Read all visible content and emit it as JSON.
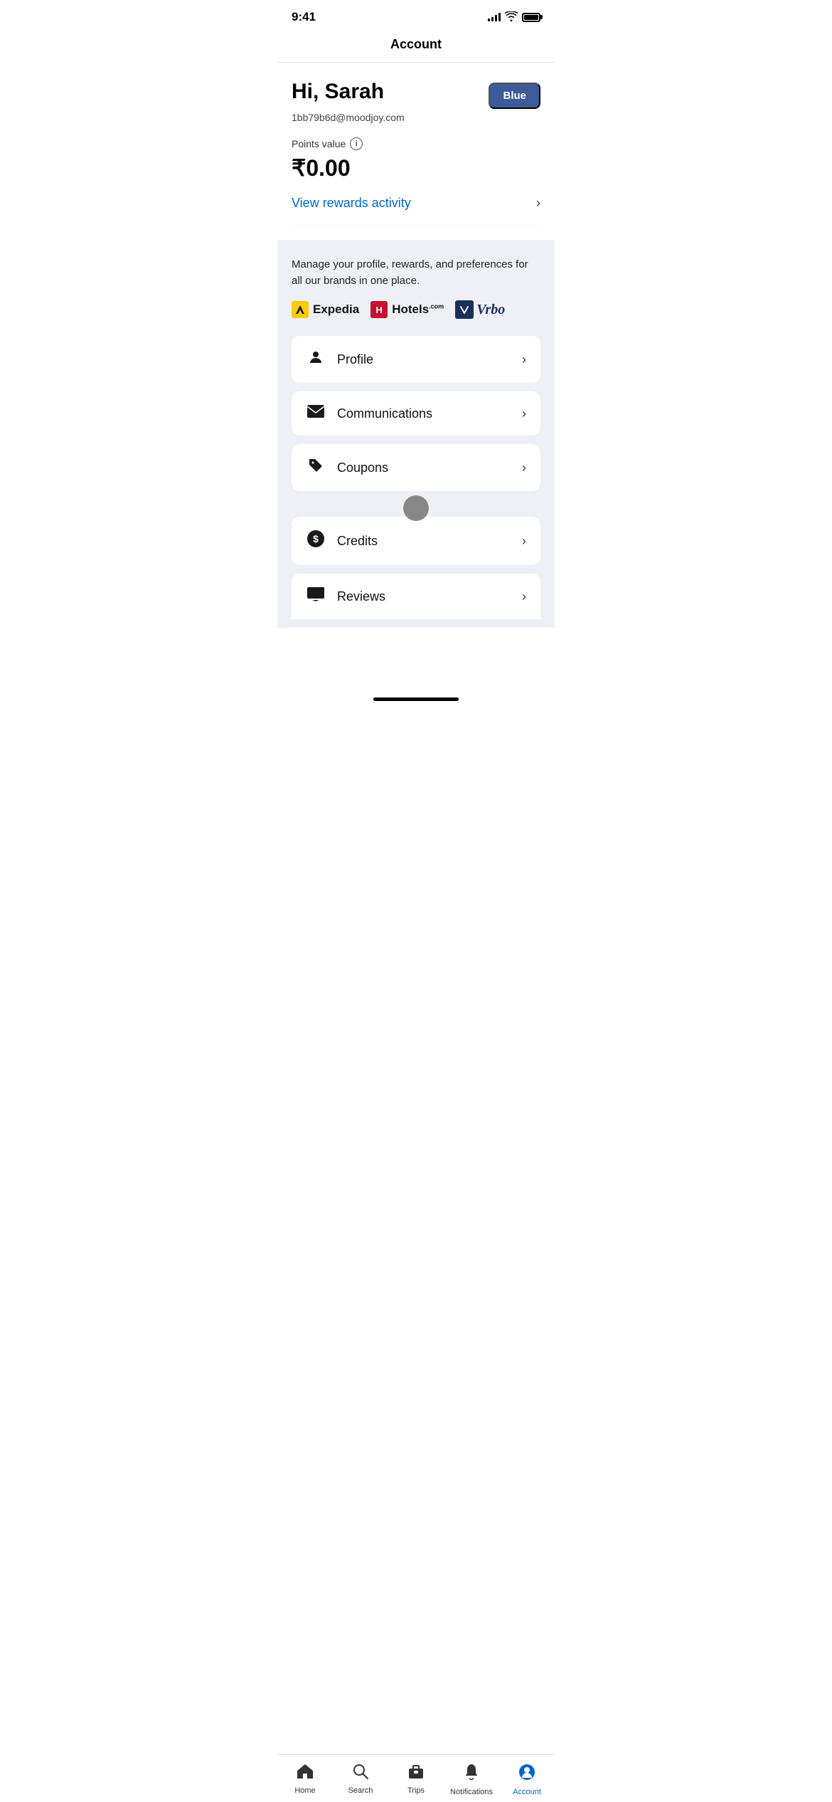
{
  "statusBar": {
    "time": "9:41"
  },
  "header": {
    "title": "Account"
  },
  "profile": {
    "greeting": "Hi, Sarah",
    "email": "1bb79b6d@moodjoy.com",
    "badge": "Blue",
    "pointsLabel": "Points value",
    "pointsValue": "₹0.00",
    "rewardsLink": "View rewards activity"
  },
  "brands": {
    "description": "Manage your profile, rewards, and preferences for all our brands in one place.",
    "expedia": "Expedia",
    "hotels": "Hotels",
    "vrbo": "Vrbo"
  },
  "menuItems": [
    {
      "id": "profile",
      "label": "Profile",
      "icon": "person"
    },
    {
      "id": "communications",
      "label": "Communications",
      "icon": "mail"
    },
    {
      "id": "coupons",
      "label": "Coupons",
      "icon": "tag"
    },
    {
      "id": "credits",
      "label": "Credits",
      "icon": "dollar"
    },
    {
      "id": "reviews",
      "label": "Reviews",
      "icon": "reviews"
    }
  ],
  "bottomNav": {
    "items": [
      {
        "id": "home",
        "label": "Home",
        "active": false
      },
      {
        "id": "search",
        "label": "Search",
        "active": false
      },
      {
        "id": "trips",
        "label": "Trips",
        "active": false
      },
      {
        "id": "notifications",
        "label": "Notifications",
        "active": false
      },
      {
        "id": "account",
        "label": "Account",
        "active": true
      }
    ]
  }
}
